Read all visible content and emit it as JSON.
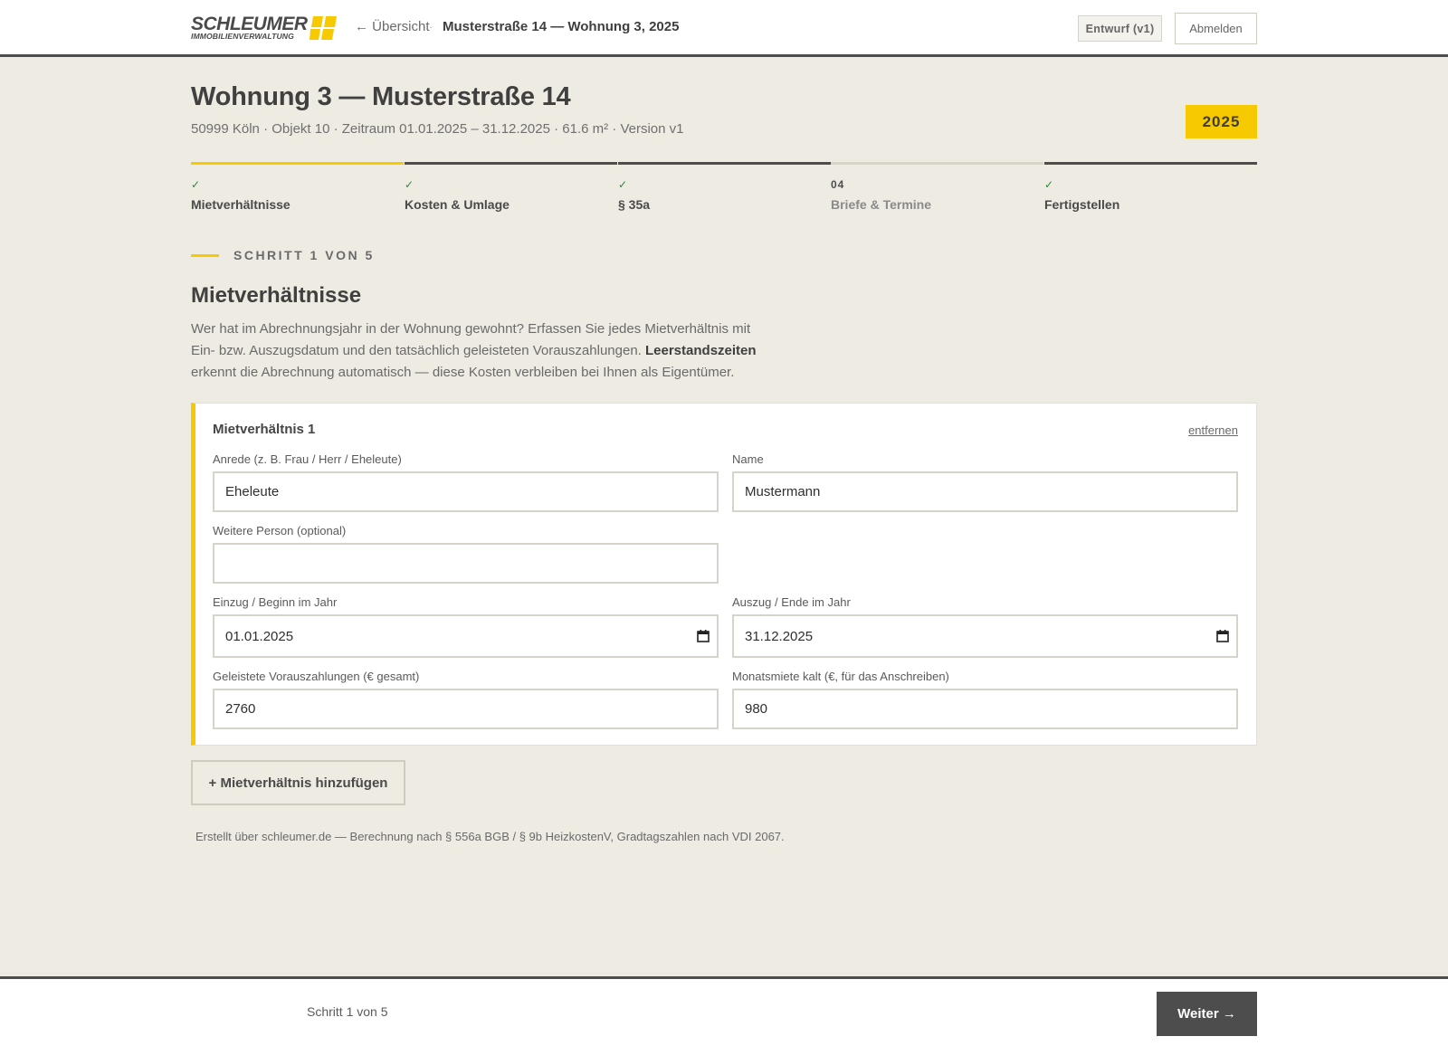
{
  "header": {
    "logo_text": "SCHLEUMER",
    "logo_sub": "IMMOBILIENVERWALTUNG",
    "back_label": "← Übersicht",
    "separator": "·",
    "breadcrumb_title": "Musterstraße 14 — Wohnung 3, 2025",
    "draft_badge": "Entwurf (v1)",
    "logout_label": "Abmelden",
    "brand_color": "#f6c900"
  },
  "page": {
    "title": "Wohnung 3 — Musterstraße 14",
    "subtitle": "50999 Köln · Objekt 10 · Zeitraum 01.01.2025 – 31.12.2025 · 61.6 m² · Version v1",
    "year": "2025"
  },
  "stepper": {
    "steps": [
      {
        "mark": "✓",
        "label": "Mietverhältnisse",
        "state": "active"
      },
      {
        "mark": "✓",
        "label": "Kosten & Umlage",
        "state": "done"
      },
      {
        "mark": "✓",
        "label": "§ 35a",
        "state": "done"
      },
      {
        "mark": "04",
        "label": "Briefe & Termine",
        "state": "pending"
      },
      {
        "mark": "✓",
        "label": "Fertigstellen",
        "state": "done"
      }
    ]
  },
  "section": {
    "eyebrow": "SCHRITT 1 VON 5",
    "title": "Mietverhältnisse",
    "intro_part1": "Wer hat im Abrechnungsjahr in der Wohnung gewohnt? Erfassen Sie jedes Mietverhältnis mit Ein- bzw. Auszugsdatum und den tatsächlich geleisteten Vorauszahlungen. ",
    "intro_bold": "Leerstandszeiten",
    "intro_part2": " erkennt die Abrechnung automatisch — diese Kosten verbleiben bei Ihnen als Eigentümer."
  },
  "tenancy": {
    "title": "Mietverhältnis 1",
    "remove_label": "entfernen",
    "salutation_label": "Anrede (z. B. Frau / Herr / Eheleute)",
    "salutation_value": "Eheleute",
    "name_label": "Name",
    "name_value": "Mustermann",
    "other_person_label": "Weitere Person (optional)",
    "other_person_value": "",
    "move_in_label": "Einzug / Beginn im Jahr",
    "move_in_value": "01.01.2025",
    "move_out_label": "Auszug / Ende im Jahr",
    "move_out_value": "31.12.2025",
    "prepayments_label": "Geleistete Vorauszahlungen (€ gesamt)",
    "prepayments_value": "2760",
    "rent_label": "Monatsmiete kalt (€, für das Anschreiben)",
    "rent_value": "980"
  },
  "actions": {
    "add_tenancy_label": "+ Mietverhältnis hinzufügen",
    "footnote": "Erstellt über schleumer.de — Berechnung nach § 556a BGB / § 9b HeizkostenV, Gradtagszahlen nach VDI 2067."
  },
  "footer": {
    "step_count": "Schritt 1 von 5",
    "next_label": "Weiter →"
  }
}
